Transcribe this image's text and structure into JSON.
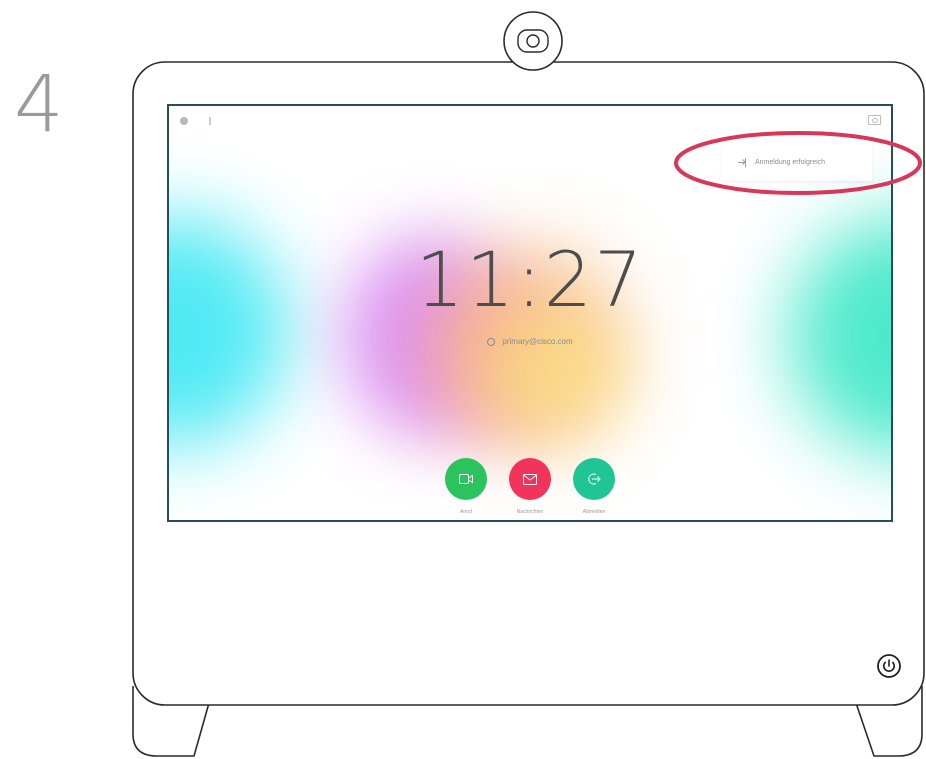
{
  "step_number": "4",
  "screen": {
    "notification": {
      "icon": "sign-in-icon",
      "text": "Anmeldung erfolgreich"
    },
    "clock": "11:27",
    "sip_address": {
      "icon": "sip-icon",
      "text": "primary@cisco.com"
    },
    "actions": [
      {
        "label": "Anruf",
        "icon": "video-camera-icon",
        "color": "#2bc35d"
      },
      {
        "label": "Nachrichten",
        "icon": "mail-icon",
        "color": "#f0345b"
      },
      {
        "label": "Abmelden",
        "icon": "sign-out-icon",
        "color": "#1fc595"
      }
    ]
  },
  "colors": {
    "highlight": "#d8375a",
    "screen_border": "#254d5a"
  }
}
